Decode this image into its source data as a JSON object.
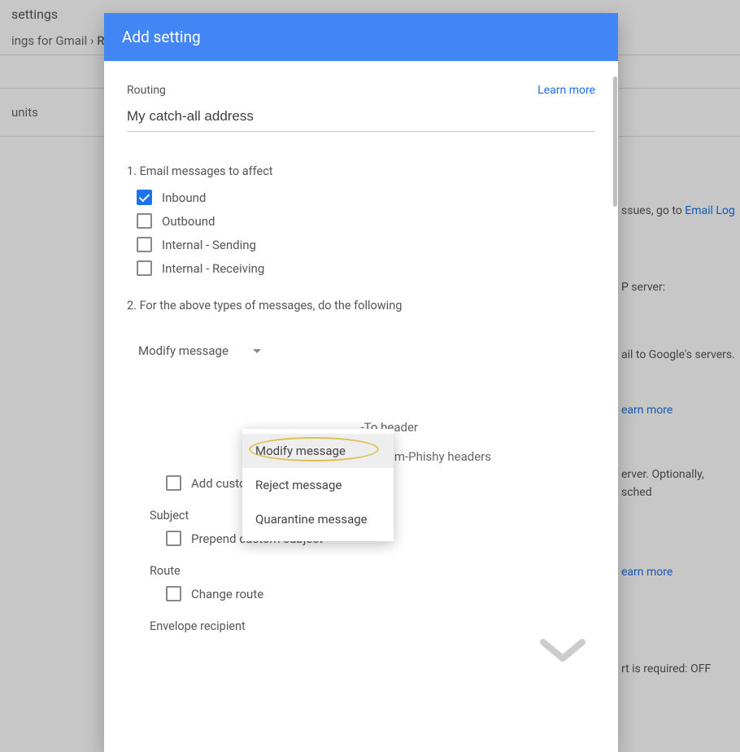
{
  "background": {
    "top_label": "settings",
    "breadcrumb_left": "ings for Gmail",
    "breadcrumb_separator": "›",
    "breadcrumb_current": "Ro",
    "units": "units",
    "right_fragments": {
      "issues_prefix": "ssues, go to ",
      "email_log": "Email Log",
      "p_server": "P server:",
      "google_servers": "ail to Google's servers.",
      "learn1": "earn more",
      "optionally": "erver. Optionally, sched",
      "learn2": "earn more",
      "required_off": "rt is required: OFF"
    }
  },
  "modal": {
    "title": "Add setting",
    "routing_label": "Routing",
    "learn_more": "Learn more",
    "name_value": "My catch-all address",
    "section1": {
      "title": "1. Email messages to affect",
      "options": [
        {
          "label": "Inbound",
          "checked": true
        },
        {
          "label": "Outbound",
          "checked": false
        },
        {
          "label": "Internal - Sending",
          "checked": false
        },
        {
          "label": "Internal - Receiving",
          "checked": false
        }
      ]
    },
    "section2": {
      "title": "2. For the above types of messages, do the following",
      "dropdown_selected": "Modify message",
      "dropdown_items": [
        "Modify message",
        "Reject message",
        "Quarantine message"
      ],
      "obscured1": "-To header",
      "obscured2": "nd X-Gm-Phishy headers",
      "headers": {
        "add_custom": "Add custom headers"
      },
      "subject": {
        "label": "Subject",
        "prepend": "Prepend custom subject"
      },
      "route": {
        "label": "Route",
        "change": "Change route"
      },
      "envelope": {
        "label": "Envelope recipient"
      }
    }
  }
}
